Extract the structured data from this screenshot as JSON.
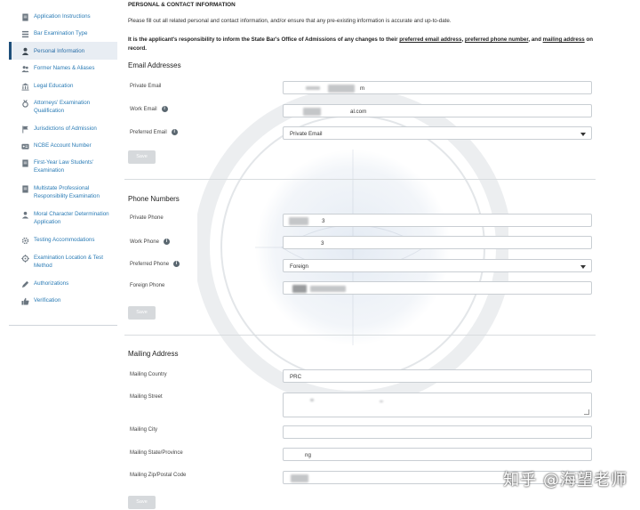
{
  "sidebar": {
    "items": [
      {
        "label": "Application Instructions",
        "icon": "document-icon"
      },
      {
        "label": "Bar Examination Type",
        "icon": "list-icon"
      },
      {
        "label": "Personal Information",
        "icon": "person-icon",
        "active": true
      },
      {
        "label": "Former Names & Aliases",
        "icon": "people-icon"
      },
      {
        "label": "Legal Education",
        "icon": "building-icon"
      },
      {
        "label": "Attorneys' Examination Qualification",
        "icon": "medal-icon"
      },
      {
        "label": "Jurisdictions of Admission",
        "icon": "flag-icon"
      },
      {
        "label": "NCBE Account Number",
        "icon": "id-card-icon"
      },
      {
        "label": "First-Year Law Students' Examination",
        "icon": "document-icon"
      },
      {
        "label": "Multistate Professional Responsibility Examination",
        "icon": "document-icon"
      },
      {
        "label": "Moral Character Determination Application",
        "icon": "person-badge-icon"
      },
      {
        "label": "Testing Accommodations",
        "icon": "gear-icon"
      },
      {
        "label": "Examination Location & Test Method",
        "icon": "location-icon"
      },
      {
        "label": "Authorizations",
        "icon": "pen-icon"
      },
      {
        "label": "Verification",
        "icon": "thumbs-up-icon"
      }
    ]
  },
  "main": {
    "heading": "PERSONAL & CONTACT INFORMATION",
    "intro": "Please fill out all related personal and contact information, and/or ensure that any pre-existing information is accurate and up-to-date.",
    "notice": {
      "prefix": "It is the applicant's responsibility to inform the State Bar's Office of Admissions of any changes to their ",
      "link1": "preferred email address",
      "sep1": ", ",
      "link2": "preferred phone number",
      "sep2": ", and ",
      "link3": "mailing address",
      "suffix": " on record."
    },
    "email": {
      "title": "Email Addresses",
      "private_label": "Private Email",
      "private_value": "m",
      "work_label": "Work Email",
      "work_value": "al.com",
      "preferred_label": "Preferred Email",
      "preferred_value": "Private Email",
      "save": "Save"
    },
    "phone": {
      "title": "Phone Numbers",
      "private_label": "Private Phone",
      "private_value": "3",
      "work_label": "Work Phone",
      "work_value": "3",
      "preferred_label": "Preferred Phone",
      "preferred_value": "Foreign",
      "foreign_label": "Foreign Phone",
      "save": "Save"
    },
    "mailing": {
      "title": "Mailing Address",
      "country_label": "Mailing Country",
      "country_value": "PRC",
      "street_label": "Mailing Street",
      "city_label": "Mailing City",
      "state_label": "Mailing State/Province",
      "state_value": "ng",
      "zip_label": "Mailing Zip/Postal Code",
      "save": "Save"
    }
  },
  "watermark": "知乎 @海望老师"
}
